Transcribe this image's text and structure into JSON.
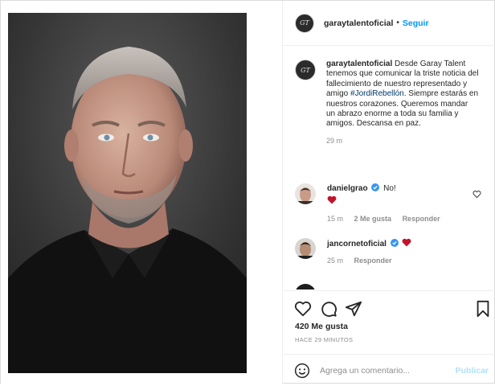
{
  "header": {
    "username": "garaytalentoficial",
    "separator": "•",
    "follow_label": "Seguir",
    "avatar_initials": "GT"
  },
  "caption": {
    "username": "garaytalentoficial",
    "text_before": " Desde Garay Talent tenemos que comunicar la triste noticia del fallecimiento de nuestro representado y amigo ",
    "hashtag": "#JordiRebellón",
    "text_after": ". Siempre estarás en nuestros corazones. Queremos mandar un abrazo enorme a toda su familia y amigos. Descansa en paz.",
    "time": "29 m"
  },
  "comments": [
    {
      "username": "danielgrao",
      "text": "No!",
      "emoji": "❤️",
      "time": "15 m",
      "likes": "2 Me gusta",
      "reply": "Responder"
    },
    {
      "username": "jancornetoficial",
      "emoji": "❤️",
      "time": "25 m",
      "reply": "Responder"
    }
  ],
  "actions": {
    "likes": "420 Me gusta",
    "ago": "HACE 29 MINUTOS"
  },
  "add_comment": {
    "placeholder": "Agrega un comentario...",
    "post_label": "Publicar"
  },
  "colors": {
    "link_blue": "#0095f6",
    "hashtag": "#00376b",
    "heart_red": "#ed4956",
    "verified": "#3897f0"
  }
}
